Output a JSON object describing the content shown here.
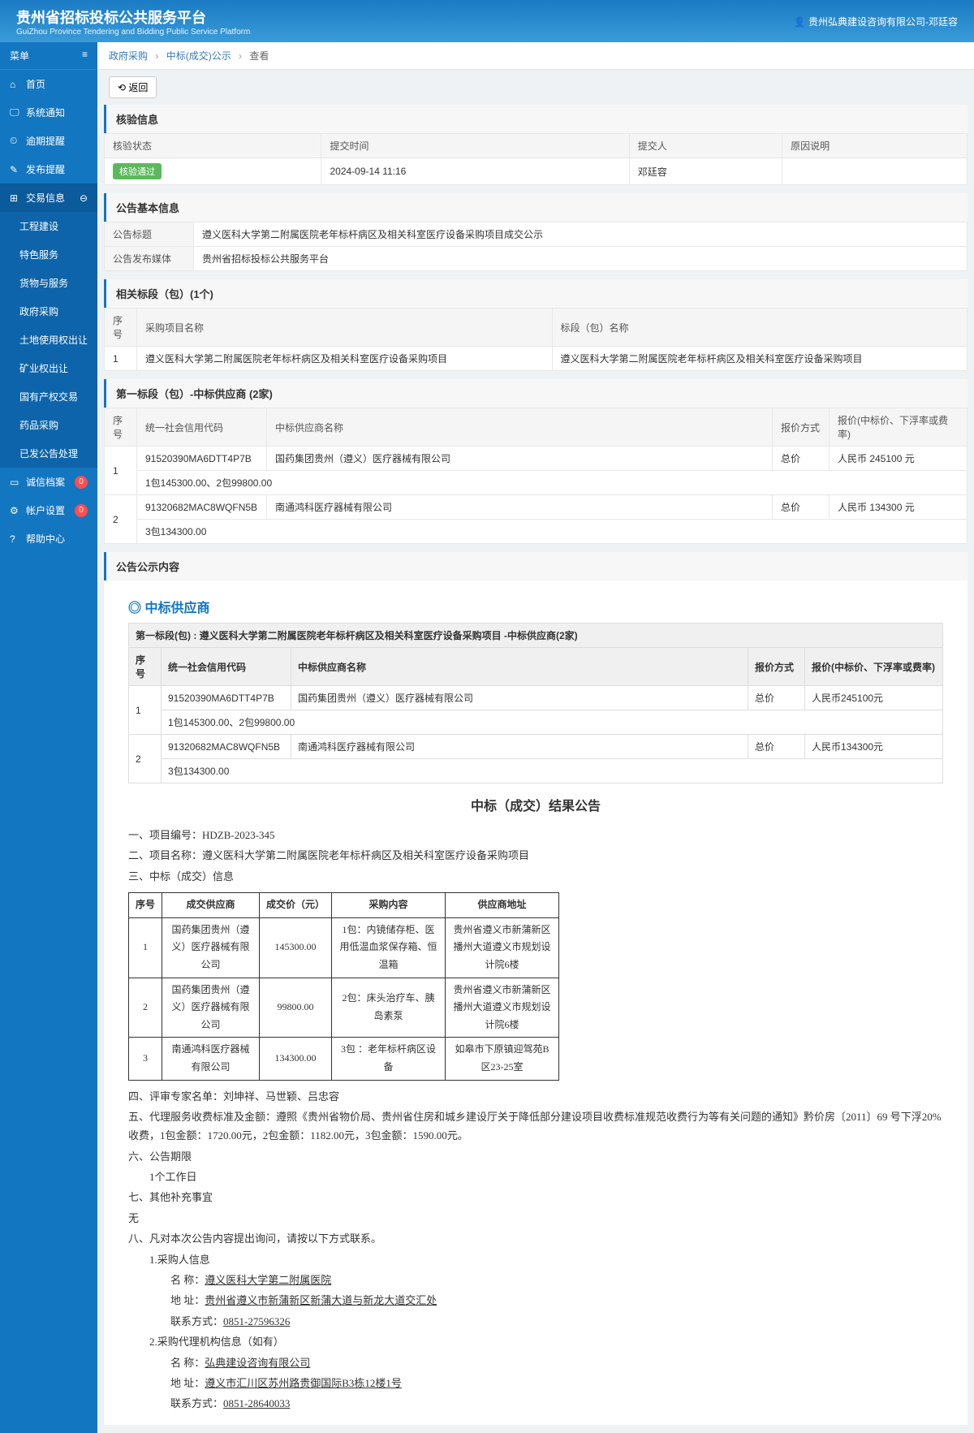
{
  "header": {
    "title": "贵州省招标投标公共服务平台",
    "subtitle": "GuiZhou Province Tendering and Bidding Public Service Platform",
    "user": "贵州弘典建设咨询有限公司-邓廷容"
  },
  "sidebar": {
    "menu_label": "菜单",
    "items": [
      {
        "icon": "⌂",
        "label": "首页"
      },
      {
        "icon": "🖵",
        "label": "系统通知"
      },
      {
        "icon": "⏲",
        "label": "逾期提醒"
      },
      {
        "icon": "✎",
        "label": "发布提醒"
      },
      {
        "icon": "⊞",
        "label": "交易信息",
        "active": true,
        "expand": true
      }
    ],
    "subitems": [
      {
        "label": "工程建设"
      },
      {
        "label": "特色服务"
      },
      {
        "label": "货物与服务"
      },
      {
        "label": "政府采购"
      },
      {
        "label": "土地使用权出让"
      },
      {
        "label": "矿业权出让"
      },
      {
        "label": "国有产权交易"
      },
      {
        "label": "药品采购"
      },
      {
        "label": "已发公告处理"
      }
    ],
    "items2": [
      {
        "icon": "▭",
        "label": "诚信档案",
        "badge": "0"
      },
      {
        "icon": "⚙",
        "label": "帐户设置",
        "badge": "0"
      },
      {
        "icon": "?",
        "label": "帮助中心"
      }
    ]
  },
  "breadcrumb": {
    "a": "政府采购",
    "b": "中标(成交)公示",
    "c": "查看"
  },
  "back_btn": "⟲ 返回",
  "verify": {
    "title": "核验信息",
    "h_status": "核验状态",
    "h_submit_time": "提交时间",
    "h_submitter": "提交人",
    "h_reason": "原因说明",
    "status": "核验通过",
    "submit_time": "2024-09-14 11:16",
    "submitter": "邓廷容",
    "reason": ""
  },
  "basic": {
    "title": "公告基本信息",
    "l_title": "公告标题",
    "v_title": "遵义医科大学第二附属医院老年标杆病区及相关科室医疗设备采购项目成交公示",
    "l_media": "公告发布媒体",
    "v_media": "贵州省招标投标公共服务平台"
  },
  "sections": {
    "title": "相关标段（包）(1个)",
    "h_seq": "序号",
    "h_proj": "采购项目名称",
    "h_section": "标段（包）名称",
    "rows": [
      {
        "seq": "1",
        "proj": "遵义医科大学第二附属医院老年标杆病区及相关科室医疗设备采购项目",
        "section": "遵义医科大学第二附属医院老年标杆病区及相关科室医疗设备采购项目"
      }
    ]
  },
  "winners": {
    "title": "第一标段（包）-中标供应商 (2家)",
    "h_seq": "序号",
    "h_code": "统一社会信用代码",
    "h_name": "中标供应商名称",
    "h_method": "报价方式",
    "h_price": "报价(中标价、下浮率或费率)",
    "rows": [
      {
        "seq": "1",
        "code": "91520390MA6DTT4P7B",
        "name": "国药集团贵州（遵义）医疗器械有限公司",
        "method": "总价",
        "price": "人民币 245100 元",
        "detail": "1包145300.00、2包99800.00"
      },
      {
        "seq": "2",
        "code": "91320682MAC8WQFN5B",
        "name": "南通鸿科医疗器械有限公司",
        "method": "总价",
        "price": "人民币 134300 元",
        "detail": "3包134300.00"
      }
    ]
  },
  "content": {
    "title": "公告公示内容",
    "supplier_heading": "中标供应商",
    "section_label": "第一标段(包) : 遵义医科大学第二附属医院老年标杆病区及相关科室医疗设备采购项目 -中标供应商(2家)",
    "inner": {
      "h_seq": "序号",
      "h_code": "统一社会信用代码",
      "h_name": "中标供应商名称",
      "h_method": "报价方式",
      "h_price": "报价(中标价、下浮率或费率)",
      "rows": [
        {
          "seq": "1",
          "code": "91520390MA6DTT4P7B",
          "name": "国药集团贵州（遵义）医疗器械有限公司",
          "method": "总价",
          "price": "人民币245100元",
          "detail": "1包145300.00、2包99800.00"
        },
        {
          "seq": "2",
          "code": "91320682MAC8WQFN5B",
          "name": "南通鸿科医疗器械有限公司",
          "method": "总价",
          "price": "人民币134300元",
          "detail": "3包134300.00"
        }
      ]
    },
    "ann_title": "中标（成交）结果公告",
    "p1": "一、项目编号：HDZB-2023-345",
    "p2": "二、项目名称：遵义医科大学第二附属医院老年标杆病区及相关科室医疗设备采购项目",
    "p3": "三、中标（成交）信息",
    "result_headers": {
      "seq": "序号",
      "supplier": "成交供应商",
      "price": "成交价（元）",
      "content": "采购内容",
      "addr": "供应商地址"
    },
    "result_rows": [
      {
        "seq": "1",
        "supplier": "国药集团贵州（遵义）医疗器械有限公司",
        "price": "145300.00",
        "content": "1包：内镜储存柜、医用低温血浆保存箱、恒温箱",
        "addr": "贵州省遵义市新蒲新区播州大道遵义市规划设计院6楼"
      },
      {
        "seq": "2",
        "supplier": "国药集团贵州（遵义）医疗器械有限公司",
        "price": "99800.00",
        "content": "2包：床头治疗车、胰岛素泵",
        "addr": "贵州省遵义市新蒲新区播州大道遵义市规划设计院6楼"
      },
      {
        "seq": "3",
        "supplier": "南通鸿科医疗器械有限公司",
        "price": "134300.00",
        "content": "3包 ：老年标杆病区设备",
        "addr": "如皋市下原镇迎驾苑B区23-25室"
      }
    ],
    "p4": "四、评审专家名单：刘坤祥、马世颖、吕忠容",
    "p5": "五、代理服务收费标准及金额：遵照《贵州省物价局、贵州省住房和城乡建设厅关于降低部分建设项目收费标准规范收费行为等有关问题的通知》黔价房〔2011〕69 号下浮20%收费，1包金额：1720.00元，2包金额：1182.00元，3包金额：1590.00元。",
    "p6": "六、公告期限",
    "p6a": "1个工作日",
    "p7": "七、其他补充事宜",
    "p7a": "无",
    "p8": "八、凡对本次公告内容提出询问，请按以下方式联系。",
    "c1_title": "1.采购人信息",
    "c1_name_l": "名     称：",
    "c1_name_v": "遵义医科大学第二附属医院",
    "c1_addr_l": "地     址：",
    "c1_addr_v": "贵州省遵义市新蒲新区新蒲大道与新龙大道交汇处",
    "c1_tel_l": "联系方式：",
    "c1_tel_v": "0851-27596326",
    "c2_title": "2.采购代理机构信息（如有）",
    "c2_name_l": "名     称：",
    "c2_name_v": "弘典建设咨询有限公司   ",
    "c2_addr_l": "地     址：",
    "c2_addr_v": "遵义市汇川区苏州路贵御国际B3栋12楼1号",
    "c2_tel_l": "联系方式：",
    "c2_tel_v": "0851-28640033"
  }
}
